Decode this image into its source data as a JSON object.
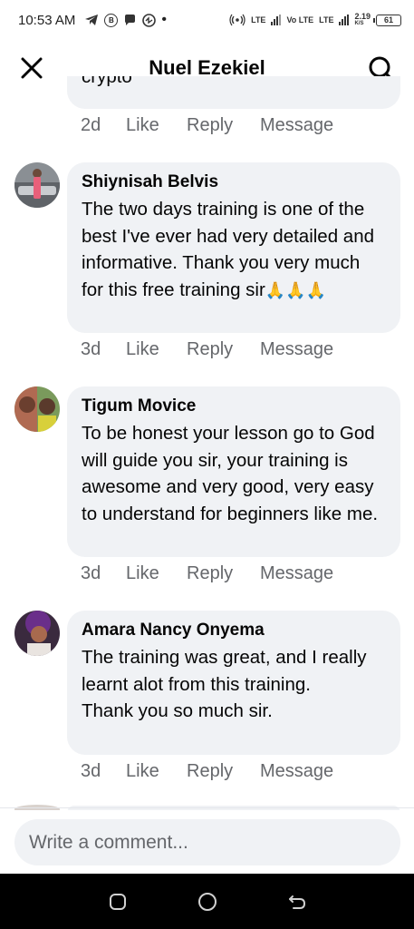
{
  "status_bar": {
    "time": "10:53 AM",
    "network_labels": [
      "LTE",
      "Vo LTE",
      "LTE"
    ],
    "speed": "2.19",
    "speed_unit": "K/S",
    "battery": "61"
  },
  "header": {
    "title": "Nuel Ezekiel"
  },
  "previous_comment": {
    "text_tail": "crypto",
    "time": "2d"
  },
  "actions": {
    "like": "Like",
    "reply": "Reply",
    "message": "Message"
  },
  "comments": [
    {
      "name": "Shiynisah Belvis",
      "text": "The two days training is one of the best I've ever had very detailed and informative. Thank you very much for this free training sir",
      "emoji": "🙏🙏🙏",
      "time": "3d"
    },
    {
      "name": "Tigum Movice",
      "text": "To be honest your lesson go to God will guide you sir, your training is awesome and very good, very easy to understand for beginners like me.",
      "time": "3d"
    },
    {
      "name": "Amara Nancy Onyema",
      "text": "The training was great, and I really learnt alot from this training.\nThank you so much sir.",
      "time": "3d"
    }
  ],
  "composer": {
    "placeholder": "Write a comment..."
  },
  "icons": {
    "close": "close-icon",
    "search": "search-icon",
    "recent": "recent-apps-icon",
    "home": "home-icon",
    "back": "back-icon"
  }
}
